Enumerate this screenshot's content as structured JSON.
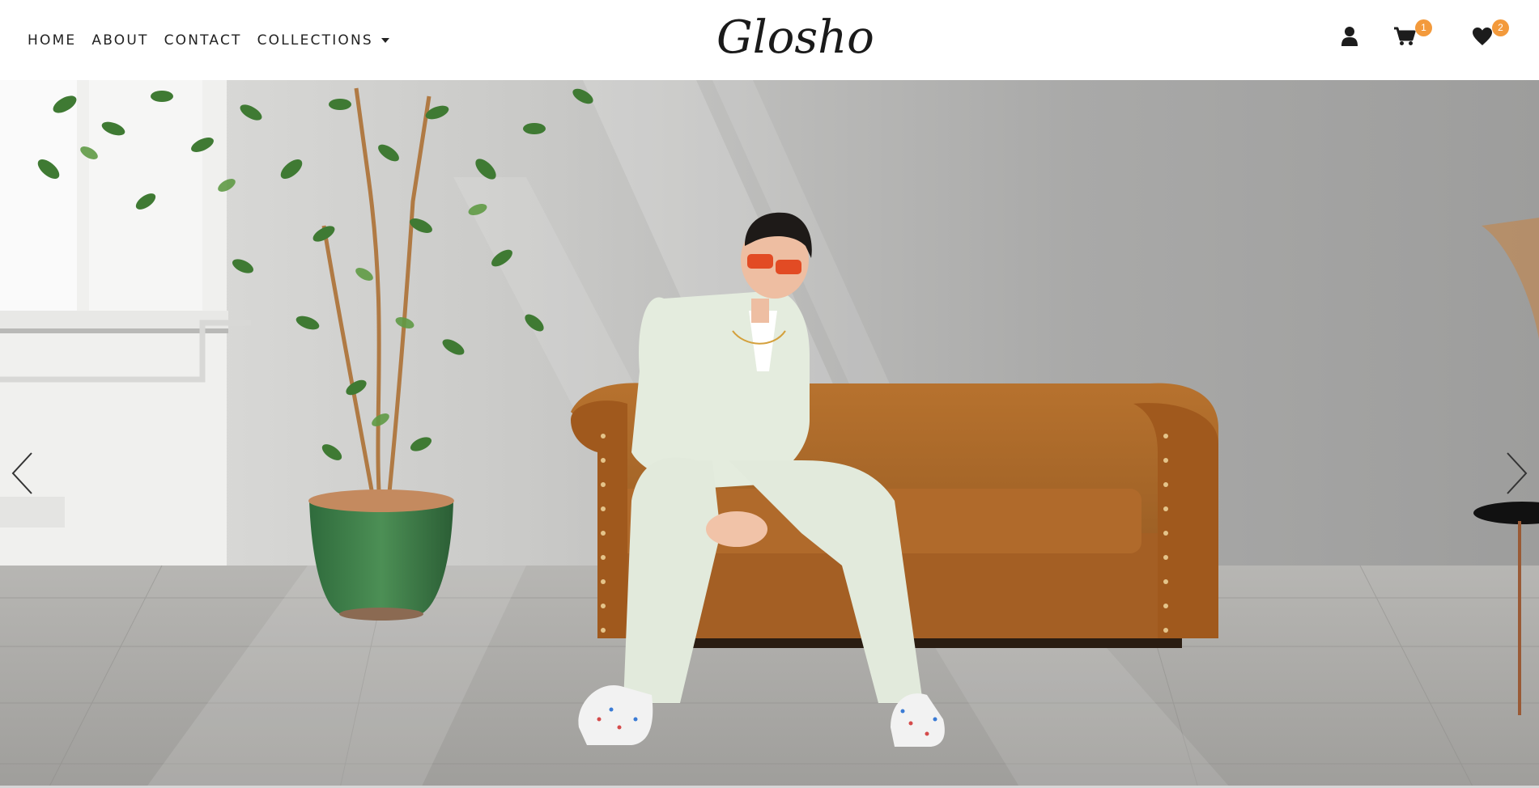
{
  "nav": {
    "links": [
      {
        "label": "HOME"
      },
      {
        "label": "ABOUT"
      },
      {
        "label": "CONTACT"
      },
      {
        "label": "COLLECTIONS"
      }
    ]
  },
  "brand": {
    "name": "Glosho"
  },
  "icons": {
    "account": "user-icon",
    "cart": "cart-icon",
    "wishlist": "heart-icon",
    "cart_count": "1",
    "wishlist_count": "2"
  },
  "hero": {
    "prev_icon": "chevron-left-icon",
    "next_icon": "chevron-right-icon"
  },
  "colors": {
    "badge": "#f39a3c",
    "text": "#222222"
  }
}
